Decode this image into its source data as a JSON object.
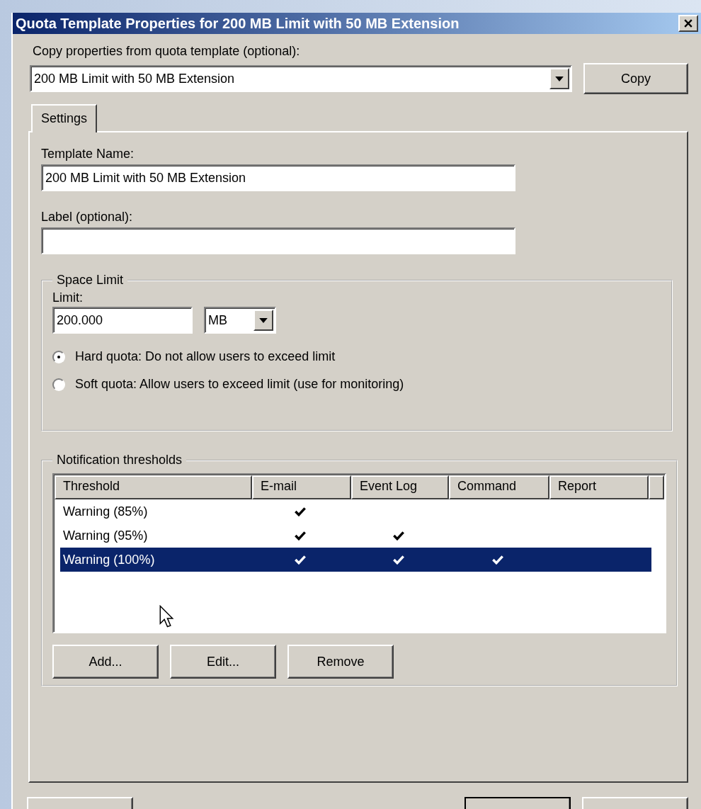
{
  "window": {
    "title": "Quota Template Properties for 200 MB Limit with 50 MB Extension"
  },
  "copy_from": {
    "label": "Copy properties from quota template (optional):",
    "value": "200 MB Limit with 50 MB Extension",
    "button": "Copy"
  },
  "tabs": [
    {
      "label": "Settings",
      "selected": true
    }
  ],
  "template_name": {
    "label": "Template Name:",
    "value": "200 MB Limit with 50 MB Extension"
  },
  "label_field": {
    "label": "Label (optional):"
  },
  "space_limit": {
    "title": "Space Limit",
    "limit_label": "Limit:",
    "limit_value": "200.000",
    "unit": "MB",
    "options": [
      {
        "label": "Hard quota: Do not allow users to exceed limit",
        "selected": true
      },
      {
        "label": "Soft quota: Allow users to exceed limit (use for monitoring)",
        "selected": false
      }
    ]
  },
  "notifications": {
    "title": "Notification thresholds",
    "columns": [
      "Threshold",
      "E-mail",
      "Event Log",
      "Command",
      "Report"
    ],
    "rows": [
      {
        "threshold": "Warning (85%)",
        "email": true,
        "event_log": false,
        "command": false,
        "report": false,
        "selected": false
      },
      {
        "threshold": "Warning (95%)",
        "email": true,
        "event_log": true,
        "command": false,
        "report": false,
        "selected": false
      },
      {
        "threshold": "Warning (100%)",
        "email": true,
        "event_log": true,
        "command": true,
        "report": false,
        "selected": true
      }
    ],
    "buttons": [
      "Add...",
      "Edit...",
      "Remove"
    ]
  },
  "footer_buttons": [
    {
      "default": false
    },
    {
      "default": true
    },
    {
      "default": false
    }
  ]
}
